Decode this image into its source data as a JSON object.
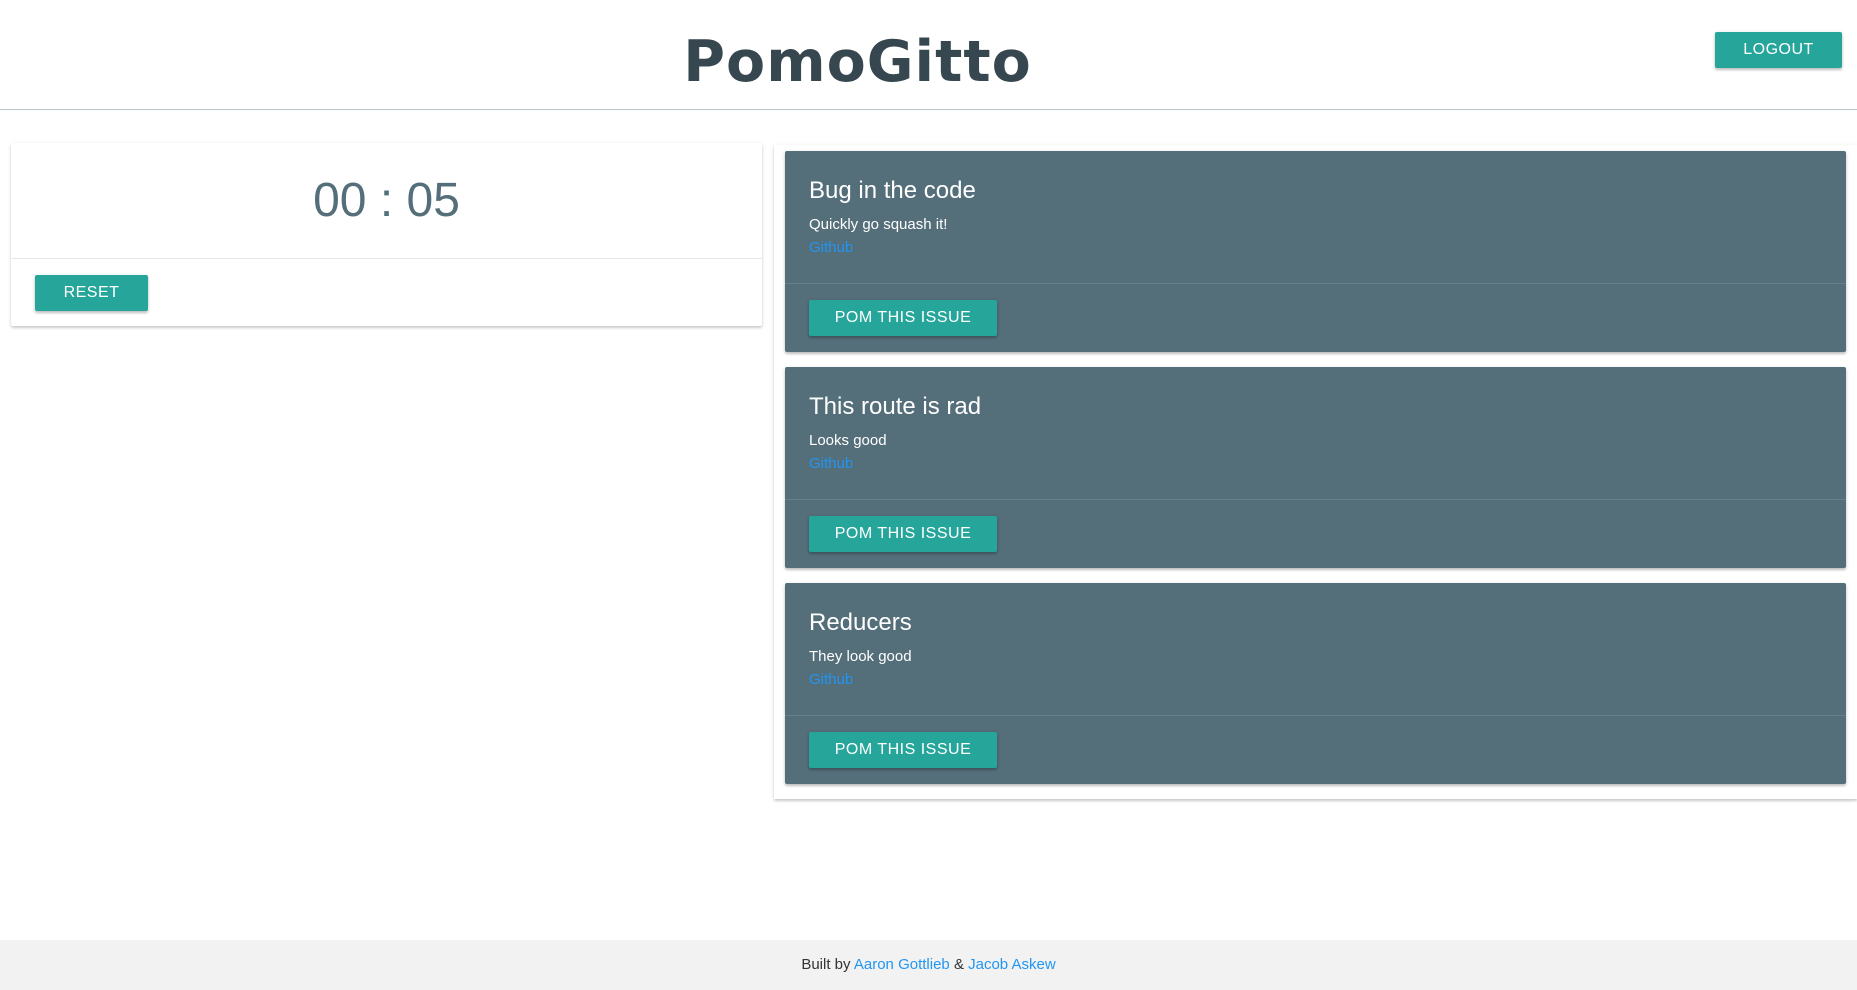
{
  "header": {
    "logo": "PomoGitto",
    "logout_label": "LOGOUT"
  },
  "timer": {
    "display": "00 : 05",
    "reset_label": "RESET"
  },
  "issues": [
    {
      "title": "Bug in the code",
      "description": "Quickly go squash it!",
      "link_label": "Github",
      "button_label": "POM THIS ISSUE"
    },
    {
      "title": "This route is rad",
      "description": "Looks good",
      "link_label": "Github",
      "button_label": "POM THIS ISSUE"
    },
    {
      "title": "Reducers",
      "description": "They look good",
      "link_label": "Github",
      "button_label": "POM THIS ISSUE"
    }
  ],
  "footer": {
    "prefix": "Built by",
    "author1": "Aaron Gottlieb",
    "separator": "&",
    "author2": "Jacob Askew"
  },
  "colors": {
    "accent": "#26a69a",
    "card": "#546e7a",
    "logo": "#36474f",
    "link": "#2196f3"
  }
}
